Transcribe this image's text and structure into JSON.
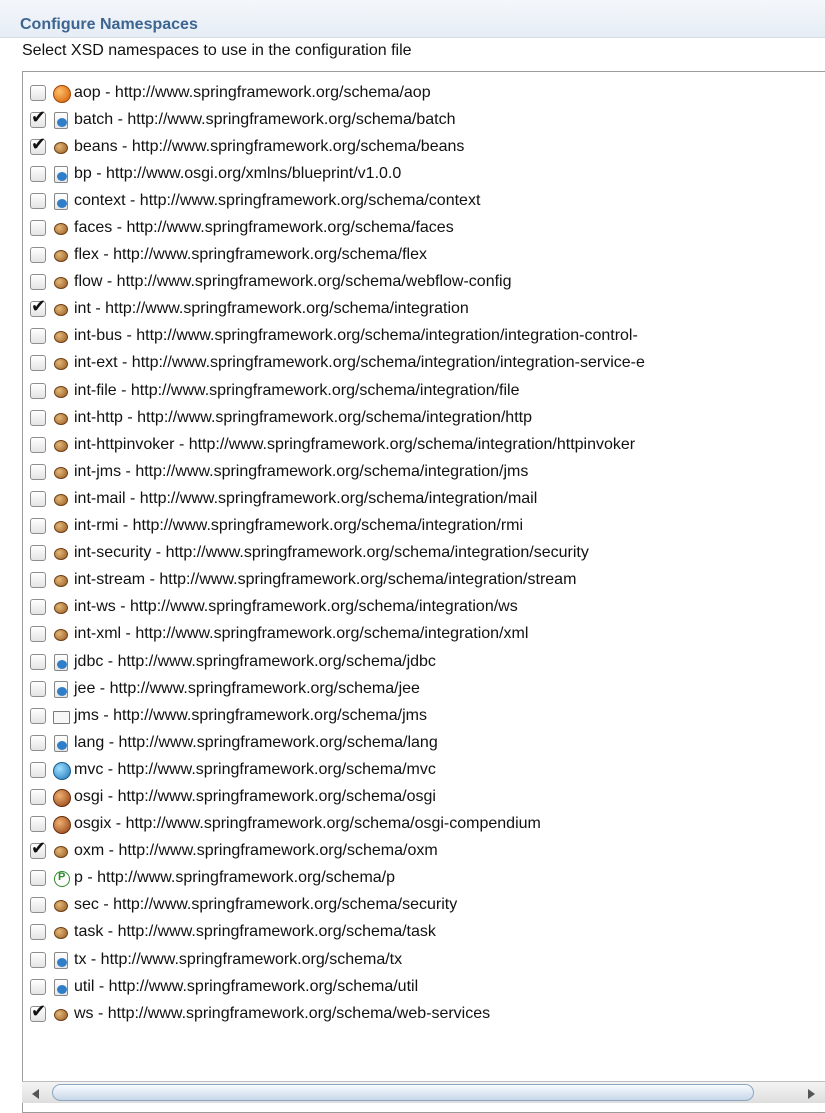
{
  "header": {
    "title": "Configure Namespaces",
    "subtitle": "Select XSD namespaces to use in the configuration file"
  },
  "items": [
    {
      "label": "aop - http://www.springframework.org/schema/aop",
      "checked": false,
      "icon": "aop-icon"
    },
    {
      "label": "batch - http://www.springframework.org/schema/batch",
      "checked": true,
      "icon": "doc-icon"
    },
    {
      "label": "beans - http://www.springframework.org/schema/beans",
      "checked": true,
      "icon": "bean-icon"
    },
    {
      "label": "bp - http://www.osgi.org/xmlns/blueprint/v1.0.0",
      "checked": false,
      "icon": "doc-icon"
    },
    {
      "label": "context - http://www.springframework.org/schema/context",
      "checked": false,
      "icon": "doc-icon"
    },
    {
      "label": "faces - http://www.springframework.org/schema/faces",
      "checked": false,
      "icon": "bean-icon"
    },
    {
      "label": "flex - http://www.springframework.org/schema/flex",
      "checked": false,
      "icon": "bean-icon"
    },
    {
      "label": "flow - http://www.springframework.org/schema/webflow-config",
      "checked": false,
      "icon": "bean-icon"
    },
    {
      "label": "int - http://www.springframework.org/schema/integration",
      "checked": true,
      "icon": "bean-icon"
    },
    {
      "label": "int-bus - http://www.springframework.org/schema/integration/integration-control-",
      "checked": false,
      "icon": "bean-icon"
    },
    {
      "label": "int-ext - http://www.springframework.org/schema/integration/integration-service-e",
      "checked": false,
      "icon": "bean-icon"
    },
    {
      "label": "int-file - http://www.springframework.org/schema/integration/file",
      "checked": false,
      "icon": "bean-icon"
    },
    {
      "label": "int-http - http://www.springframework.org/schema/integration/http",
      "checked": false,
      "icon": "bean-icon"
    },
    {
      "label": "int-httpinvoker - http://www.springframework.org/schema/integration/httpinvoker",
      "checked": false,
      "icon": "bean-icon"
    },
    {
      "label": "int-jms - http://www.springframework.org/schema/integration/jms",
      "checked": false,
      "icon": "bean-icon"
    },
    {
      "label": "int-mail - http://www.springframework.org/schema/integration/mail",
      "checked": false,
      "icon": "bean-icon"
    },
    {
      "label": "int-rmi - http://www.springframework.org/schema/integration/rmi",
      "checked": false,
      "icon": "bean-icon"
    },
    {
      "label": "int-security - http://www.springframework.org/schema/integration/security",
      "checked": false,
      "icon": "bean-icon"
    },
    {
      "label": "int-stream - http://www.springframework.org/schema/integration/stream",
      "checked": false,
      "icon": "bean-icon"
    },
    {
      "label": "int-ws - http://www.springframework.org/schema/integration/ws",
      "checked": false,
      "icon": "bean-icon"
    },
    {
      "label": "int-xml - http://www.springframework.org/schema/integration/xml",
      "checked": false,
      "icon": "bean-icon"
    },
    {
      "label": "jdbc - http://www.springframework.org/schema/jdbc",
      "checked": false,
      "icon": "doc-icon"
    },
    {
      "label": "jee - http://www.springframework.org/schema/jee",
      "checked": false,
      "icon": "doc-icon"
    },
    {
      "label": "jms - http://www.springframework.org/schema/jms",
      "checked": false,
      "icon": "mail-icon"
    },
    {
      "label": "lang - http://www.springframework.org/schema/lang",
      "checked": false,
      "icon": "doc-icon"
    },
    {
      "label": "mvc - http://www.springframework.org/schema/mvc",
      "checked": false,
      "icon": "globe-icon"
    },
    {
      "label": "osgi - http://www.springframework.org/schema/osgi",
      "checked": false,
      "icon": "osgi-icon"
    },
    {
      "label": "osgix - http://www.springframework.org/schema/osgi-compendium",
      "checked": false,
      "icon": "osgi-icon"
    },
    {
      "label": "oxm - http://www.springframework.org/schema/oxm",
      "checked": true,
      "icon": "bean-icon"
    },
    {
      "label": "p - http://www.springframework.org/schema/p",
      "checked": false,
      "icon": "p-icon"
    },
    {
      "label": "sec - http://www.springframework.org/schema/security",
      "checked": false,
      "icon": "bean-icon"
    },
    {
      "label": "task - http://www.springframework.org/schema/task",
      "checked": false,
      "icon": "bean-icon"
    },
    {
      "label": "tx - http://www.springframework.org/schema/tx",
      "checked": false,
      "icon": "doc-icon"
    },
    {
      "label": "util - http://www.springframework.org/schema/util",
      "checked": false,
      "icon": "doc-icon"
    },
    {
      "label": "ws - http://www.springframework.org/schema/web-services",
      "checked": true,
      "icon": "bean-icon"
    }
  ],
  "scrollbar": {
    "left_arrow_icon": "chevron-left-icon",
    "right_arrow_icon": "chevron-right-icon"
  }
}
